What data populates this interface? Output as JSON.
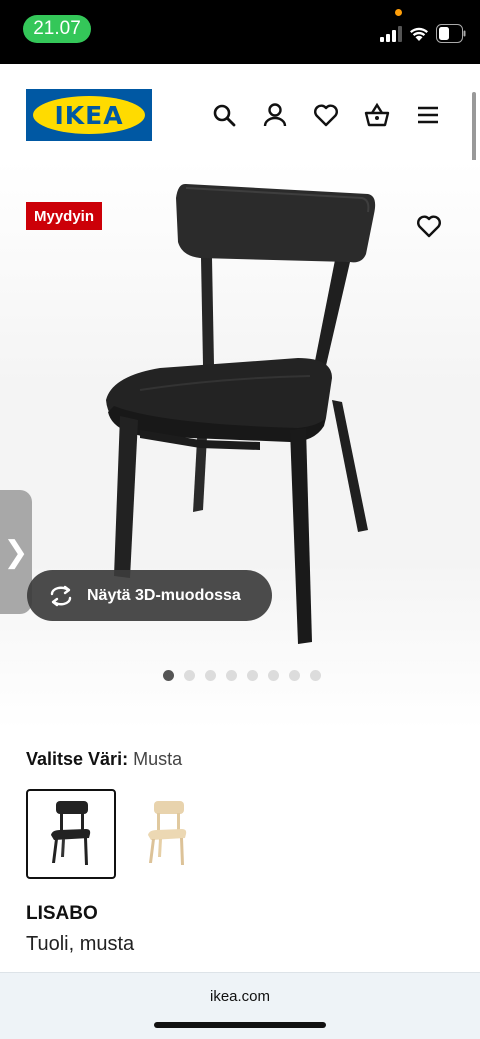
{
  "status_bar": {
    "time": "21.07"
  },
  "header": {
    "logo_text": "IKEA",
    "icons": [
      "search-icon",
      "user-icon",
      "heart-icon",
      "basket-icon",
      "menu-icon"
    ]
  },
  "product": {
    "badge": "Myydyin",
    "view_3d_label": "Näytä 3D-muodossa",
    "image_count": 8,
    "active_image": 1,
    "color_label": "Valitse Väri:",
    "color_value": "Musta",
    "name": "LISABO",
    "description": "Tuoli, musta"
  },
  "colors": {
    "brand_blue": "#0058a3",
    "brand_yellow": "#ffdb00",
    "badge_red": "#cc0008"
  },
  "browser": {
    "url": "ikea.com"
  }
}
